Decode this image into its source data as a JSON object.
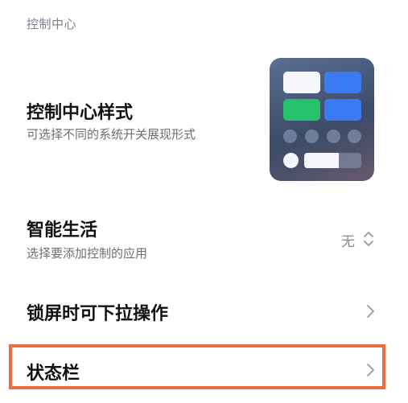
{
  "section": {
    "header": "控制中心"
  },
  "style_item": {
    "title": "控制中心样式",
    "subtitle": "可选择不同的系统开关展现形式"
  },
  "smart_life_item": {
    "title": "智能生活",
    "subtitle": "选择要添加控制的应用",
    "value": "无"
  },
  "lockscreen_item": {
    "title": "锁屏时可下拉操作"
  },
  "statusbar_item": {
    "title": "状态栏"
  },
  "preview": {
    "slider_level": 0.6
  },
  "colors": {
    "highlight": "#ee6f3d",
    "toggle_blue": "#3b7bf2",
    "toggle_green": "#25c26b"
  }
}
